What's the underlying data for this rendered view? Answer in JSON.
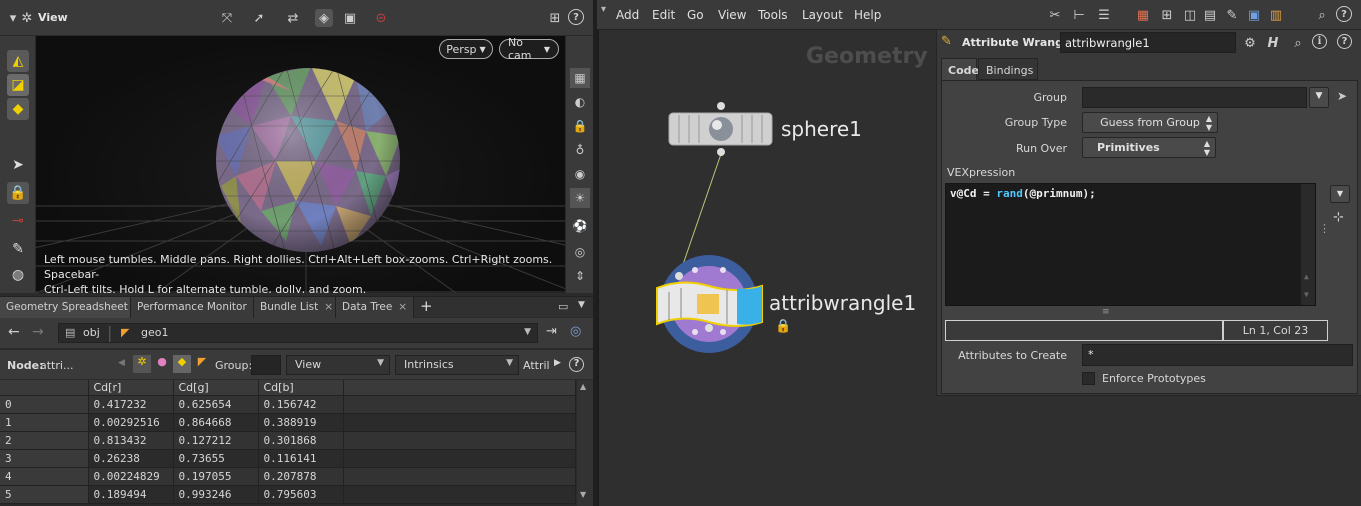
{
  "viewport": {
    "title": "View",
    "persp_label": "Persp",
    "cam_label": "No cam",
    "hint_line1": "Left mouse tumbles. Middle pans. Right dollies. Ctrl+Alt+Left box-zooms. Ctrl+Right zooms. Spacebar-",
    "hint_line2": "Ctrl-Left tilts. Hold L for alternate tumble, dolly, and zoom."
  },
  "pane_tabs": [
    {
      "label": "Geometry Spreadsheet",
      "active": true
    },
    {
      "label": "Performance Monitor",
      "active": false
    },
    {
      "label": "Bundle List",
      "active": false
    },
    {
      "label": "Data Tree",
      "active": false
    }
  ],
  "tab_close": "×",
  "tab_add": "+",
  "path": {
    "obj": "obj",
    "geo": "geo1"
  },
  "spreadsheet": {
    "node_prefix": "Node:",
    "node_name": "attri...",
    "group_label": "Group:",
    "view_label": "View",
    "intrinsics_label": "Intrinsics",
    "attrib_label": "Attril",
    "columns": [
      "",
      "Cd[r]",
      "Cd[g]",
      "Cd[b]"
    ],
    "rows": [
      [
        "0",
        "0.417232",
        "0.625654",
        "0.156742"
      ],
      [
        "1",
        "0.00292516",
        "0.864668",
        "0.388919"
      ],
      [
        "2",
        "0.813432",
        "0.127212",
        "0.301868"
      ],
      [
        "3",
        "0.26238",
        "0.73655",
        "0.116141"
      ],
      [
        "4",
        "0.00224829",
        "0.197055",
        "0.207878"
      ],
      [
        "5",
        "0.189494",
        "0.993246",
        "0.795603"
      ]
    ]
  },
  "menubar": [
    "Add",
    "Edit",
    "Go",
    "View",
    "Tools",
    "Layout",
    "Help"
  ],
  "network": {
    "context_title": "Geometry",
    "nodes": [
      {
        "name": "sphere1"
      },
      {
        "name": "attribwrangle1"
      }
    ]
  },
  "params": {
    "node_type": "Attribute Wrangle",
    "node_name": "attribwrangle1",
    "tabs": [
      "Code",
      "Bindings"
    ],
    "group_label": "Group",
    "group_value": "",
    "group_type_label": "Group Type",
    "group_type_value": "Guess from Group",
    "run_over_label": "Run Over",
    "run_over_value": "Primitives",
    "vex_label": "VEXpression",
    "vex_code_prefix": "v@Cd = ",
    "vex_code_func": "rand",
    "vex_code_suffix": "(@primnum);",
    "cursor_pos": "Ln 1, Col 23",
    "attrs_create_label": "Attributes to Create",
    "attrs_create_value": "*",
    "enforce_label": "Enforce Prototypes"
  },
  "colors": {
    "accent_yellow": "#f0d000",
    "wrangle_blue": "#3c5e9e",
    "wrangle_purple": "#a07ad0",
    "code_keyword": "#50c8ff"
  }
}
